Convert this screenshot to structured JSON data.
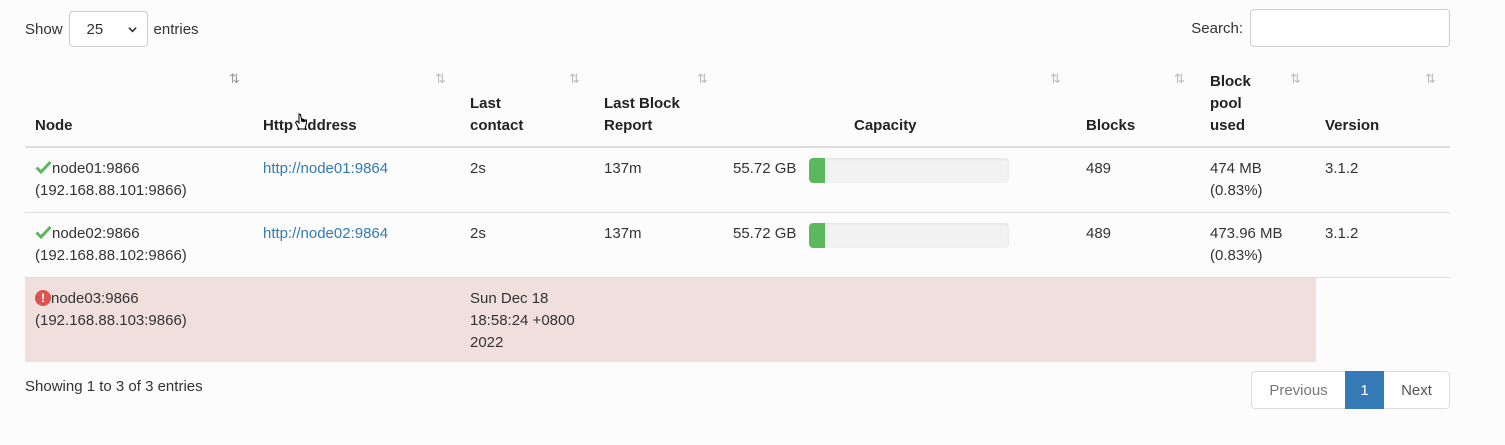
{
  "length_menu": {
    "show_label": "Show",
    "value": "25",
    "entries_label": "entries"
  },
  "search": {
    "label": "Search:",
    "value": ""
  },
  "columns": [
    {
      "lines": [
        "Node"
      ]
    },
    {
      "lines": [
        "Http Address"
      ]
    },
    {
      "lines": [
        "Last",
        "contact"
      ]
    },
    {
      "lines": [
        "Last Block",
        "Report"
      ]
    },
    {
      "lines": [
        "Capacity"
      ]
    },
    {
      "lines": [
        "Blocks"
      ]
    },
    {
      "lines": [
        "Block",
        "pool",
        "used"
      ]
    },
    {
      "lines": [
        "Version"
      ]
    }
  ],
  "rows": [
    {
      "status": "ok",
      "node": "node01:9866",
      "ip": "(192.168.88.101:9866)",
      "http": "http://node01:9864",
      "last_contact": "2s",
      "last_report": "137m",
      "capacity": "55.72 GB",
      "capacity_used_pct": 8,
      "blocks": "489",
      "pool_used": "474 MB",
      "pool_pct": "(0.83%)",
      "version": "3.1.2"
    },
    {
      "status": "ok",
      "node": "node02:9866",
      "ip": "(192.168.88.102:9866)",
      "http": "http://node02:9864",
      "last_contact": "2s",
      "last_report": "137m",
      "capacity": "55.72 GB",
      "capacity_used_pct": 8,
      "blocks": "489",
      "pool_used": "473.96 MB",
      "pool_pct": "(0.83%)",
      "version": "3.1.2"
    },
    {
      "status": "dead",
      "node": "node03:9866",
      "ip": "(192.168.88.103:9866)",
      "last_contact_lines": [
        "Sun Dec 18",
        "18:58:24 +0800",
        "2022"
      ]
    }
  ],
  "footer": {
    "info": "Showing 1 to 3 of 3 entries",
    "previous": "Previous",
    "current_page": "1",
    "next": "Next"
  },
  "colors": {
    "ok_check": "#5cb85c",
    "dead_row_bg": "#f1dfdd",
    "error_icon": "#d9534f",
    "link": "#337ab7",
    "page_active": "#337ab7"
  }
}
